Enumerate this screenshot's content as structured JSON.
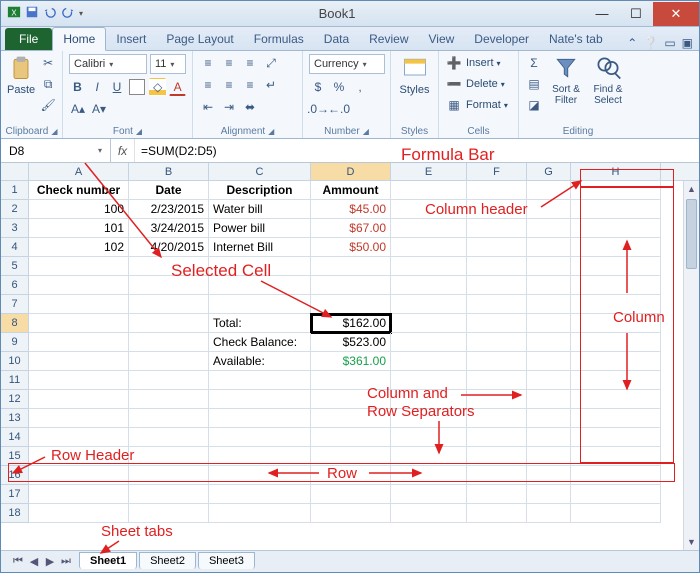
{
  "window": {
    "title": "Book1"
  },
  "qat": {
    "icons": [
      "excel-icon",
      "save-icon",
      "undo-icon",
      "redo-icon"
    ]
  },
  "file_tab": "File",
  "tabs": [
    "Home",
    "Insert",
    "Page Layout",
    "Formulas",
    "Data",
    "Review",
    "View",
    "Developer",
    "Nate's tab"
  ],
  "active_tab": "Home",
  "ribbon": {
    "clipboard": {
      "label": "Clipboard",
      "paste": "Paste"
    },
    "font": {
      "label": "Font",
      "face": "Calibri",
      "size": "11"
    },
    "alignment": {
      "label": "Alignment"
    },
    "number": {
      "label": "Number",
      "format": "Currency"
    },
    "styles": {
      "label": "Styles",
      "btn": "Styles"
    },
    "cells": {
      "label": "Cells",
      "insert": "Insert",
      "delete": "Delete",
      "format": "Format"
    },
    "editing": {
      "label": "Editing",
      "sortfilter": "Sort & Filter",
      "findselect": "Find & Select"
    }
  },
  "namebox": "D8",
  "formula": "=SUM(D2:D5)",
  "columns": [
    "A",
    "B",
    "C",
    "D",
    "E",
    "F",
    "G",
    "H"
  ],
  "headers": {
    "A": "Check number",
    "B": "Date",
    "C": "Description",
    "D": "Ammount"
  },
  "data_rows": [
    {
      "A": "100",
      "B": "2/23/2015",
      "C": "Water bill",
      "D": "$45.00"
    },
    {
      "A": "101",
      "B": "3/24/2015",
      "C": "Power bill",
      "D": "$67.00"
    },
    {
      "A": "102",
      "B": "4/20/2015",
      "C": "Internet Bill",
      "D": "$50.00"
    }
  ],
  "totals": [
    {
      "C": "Total:",
      "D": "$162.00",
      "cls": ""
    },
    {
      "C": "Check Balance:",
      "D": "$523.00",
      "cls": ""
    },
    {
      "C": "Available:",
      "D": "$361.00",
      "cls": "green"
    }
  ],
  "row_numbers": [
    "1",
    "2",
    "3",
    "4",
    "5",
    "6",
    "7",
    "8",
    "9",
    "10",
    "11",
    "12",
    "13",
    "14",
    "15",
    "16",
    "17",
    "18"
  ],
  "sheets": [
    "Sheet1",
    "Sheet2",
    "Sheet3"
  ],
  "active_sheet": "Sheet1",
  "annotations": {
    "formula_bar": "Formula Bar",
    "column_header": "Column header",
    "selected_cell": "Selected Cell",
    "column": "Column",
    "col_row_sep1": "Column and",
    "col_row_sep2": "Row Separators",
    "row_header": "Row Header",
    "row": "Row",
    "sheet_tabs": "Sheet tabs"
  },
  "chart_data": {
    "type": "table",
    "title": "Book1",
    "columns": [
      "Check number",
      "Date",
      "Description",
      "Ammount"
    ],
    "rows": [
      [
        100,
        "2/23/2015",
        "Water bill",
        45.0
      ],
      [
        101,
        "3/24/2015",
        "Power bill",
        67.0
      ],
      [
        102,
        "4/20/2015",
        "Internet Bill",
        50.0
      ]
    ],
    "summary": {
      "Total": 162.0,
      "Check Balance": 523.0,
      "Available": 361.0
    },
    "selected_cell": "D8",
    "formula": "=SUM(D2:D5)"
  }
}
